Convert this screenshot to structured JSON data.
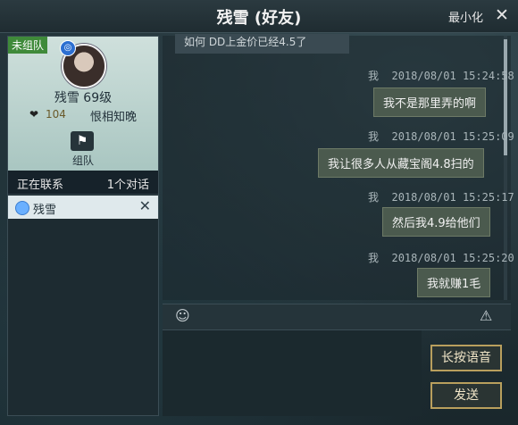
{
  "window": {
    "title": "残雪 (好友)",
    "minimize_label": "最小化",
    "close_glyph": "✕"
  },
  "profile": {
    "team_tag": "未组队",
    "name_level": "残雪  69级",
    "favor": "104",
    "relation": "恨相知晚",
    "team_button": "组队"
  },
  "contacts": {
    "header_left": "正在联系",
    "header_right": "1个对话",
    "items": [
      {
        "name": "残雪"
      }
    ]
  },
  "messages": [
    {
      "sender": "我",
      "time": "2018/08/01  15:24:58",
      "text": "我不是那里弄的啊"
    },
    {
      "sender": "我",
      "time": "2018/08/01  15:25:09",
      "text": "我让很多人从藏宝阁4.8扫的"
    },
    {
      "sender": "我",
      "time": "2018/08/01  15:25:17",
      "text": "然后我4.9给他们"
    },
    {
      "sender": "我",
      "time": "2018/08/01  15:25:20",
      "text": "我就赚1毛"
    }
  ],
  "partial_top_message": "如何 DD上金价已经4.5了",
  "buttons": {
    "voice": "长按语音",
    "send": "发送"
  },
  "icons": {
    "emoji": "smile-icon",
    "warning": "warning-icon"
  }
}
